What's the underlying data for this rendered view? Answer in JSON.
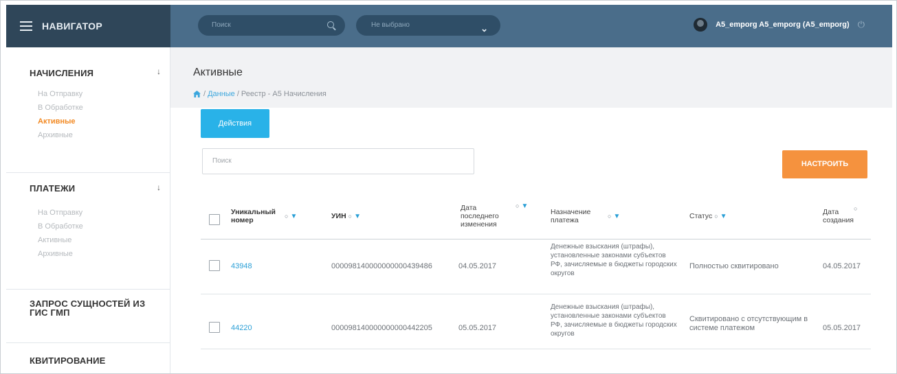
{
  "header": {
    "brand": "НАВИГАТОР",
    "search_placeholder": "Поиск",
    "select_value": "Не выбрано",
    "user": "A5_emporg A5_emporg (A5_emporg)"
  },
  "sidebar": {
    "sections": [
      {
        "title": "НАЧИСЛЕНИЯ",
        "items": [
          "На Отправку",
          "В Обработке",
          "Активные",
          "Архивные"
        ],
        "active": "Активные"
      },
      {
        "title": "ПЛАТЕЖИ",
        "items": [
          "На Отправку",
          "В Обработке",
          "Активные",
          "Архивные"
        ]
      },
      {
        "title": "ЗАПРОС СУЩНОСТЕЙ ИЗ ГИС ГМП"
      },
      {
        "title": "КВИТИРОВАНИЕ"
      }
    ]
  },
  "main": {
    "title": "Активные",
    "breadcrumb": {
      "sep1": "/",
      "link": "Данные",
      "sep2": "/",
      "rest": "Реестр - A5 Начисления"
    },
    "actions_label": "Действия",
    "filter_placeholder": "Поиск",
    "configure_label": "НАСТРОИТЬ"
  },
  "table": {
    "columns": [
      "Уникальный номер",
      "УИН",
      "Дата последнего изменения",
      "Назначение платежа",
      "Статус",
      "Дата создания"
    ],
    "rows": [
      {
        "id": "43948",
        "uin": "000098140000000000439486",
        "modified": "04.05.2017",
        "purpose": "Денежные взыскания (штрафы), установленные законами субъектов РФ, зачисляемые в бюджеты городских округов",
        "status": "Полностью сквитировано",
        "created": "04.05.2017"
      },
      {
        "id": "44220",
        "uin": "000098140000000000442205",
        "modified": "05.05.2017",
        "purpose": "Денежные взыскания (штрафы), установленные законами субъектов РФ, зачисляемые в бюджеты городских округов",
        "status": "Сквитировано с отсутствующим в системе платежом",
        "created": "05.05.2017"
      }
    ]
  },
  "colors": {
    "nav_dark": "#2f4659",
    "nav_bar": "#4a6d8a",
    "accent_blue": "#29b2e8",
    "accent_orange": "#f5923e",
    "active_item": "#f28a24",
    "link": "#2a9fd6"
  },
  "icons": [
    "menu-icon",
    "search-icon",
    "chevron-down-icon",
    "avatar",
    "logout-icon",
    "home-icon",
    "sort-icon",
    "filter-icon"
  ]
}
